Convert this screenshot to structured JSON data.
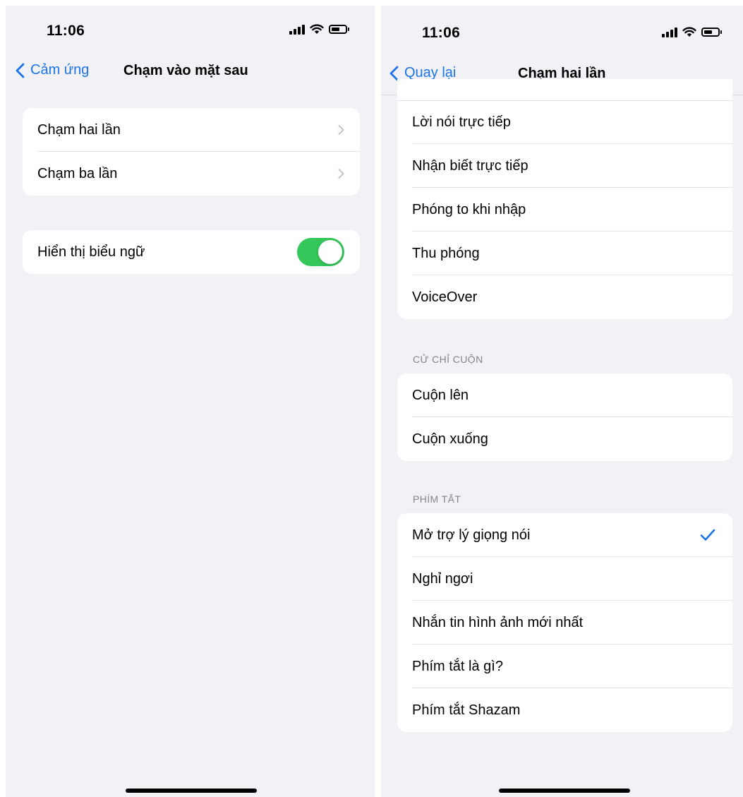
{
  "left": {
    "status": {
      "time": "11:06"
    },
    "nav": {
      "back_label": "Cảm ứng",
      "title": "Chạm vào mặt sau"
    },
    "tap_group": [
      "Chạm hai lần",
      "Chạm ba lần"
    ],
    "banner": {
      "label": "Hiển thị biểu ngữ",
      "toggle_on": true
    }
  },
  "right": {
    "status": {
      "time": "11:06"
    },
    "nav": {
      "back_label": "Quay lại",
      "title": "Chạm hai lần"
    },
    "accessibility_items": [
      "Lời nói trực tiếp",
      "Nhận biết trực tiếp",
      "Phóng to khi nhập",
      "Thu phóng",
      "VoiceOver"
    ],
    "scroll_header": "CỬ CHỈ CUỘN",
    "scroll_items": [
      "Cuộn lên",
      "Cuộn xuống"
    ],
    "shortcut_header": "PHÍM TẮT",
    "shortcut_items": [
      "Mở trợ lý giọng nói",
      "Nghỉ ngơi",
      "Nhắn tin hình ảnh mới nhất",
      "Phím tắt là gì?",
      "Phím tắt Shazam"
    ],
    "selected_shortcut": "Mở trợ lý giọng nói"
  },
  "colors": {
    "accent": "#1c74e9",
    "toggle_on": "#34c759",
    "background": "#f2f1f6",
    "section_text": "#858589"
  },
  "icons": [
    "signal-icon",
    "wifi-icon",
    "battery-icon",
    "chevron-left-icon",
    "chevron-right-icon",
    "checkmark-icon"
  ]
}
